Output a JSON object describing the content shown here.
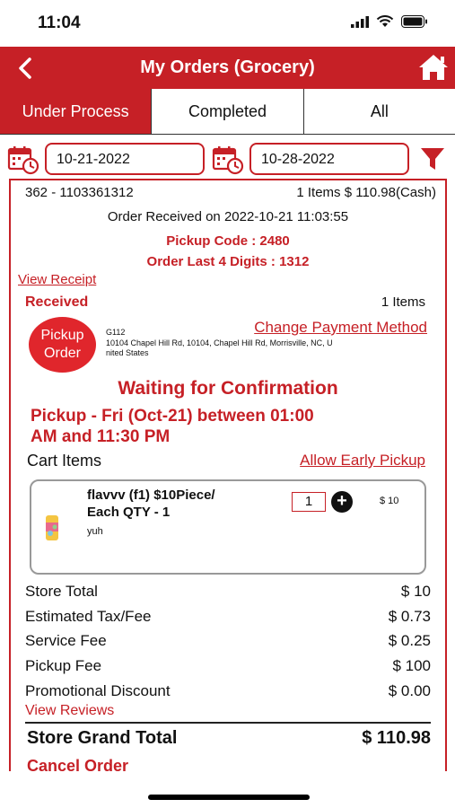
{
  "status_bar": {
    "time": "11:04"
  },
  "nav": {
    "title": "My Orders (Grocery)",
    "back_icon": "chevron-left-icon",
    "home_icon": "home-icon"
  },
  "tabs": [
    {
      "label": "Under Process",
      "active": true
    },
    {
      "label": "Completed",
      "active": false
    },
    {
      "label": "All",
      "active": false
    }
  ],
  "filters": {
    "from_date": "10-21-2022",
    "to_date": "10-28-2022"
  },
  "order": {
    "id": "362 - 1103361312",
    "summary": "1 Items $ 110.98(Cash)",
    "received_on": "Order Received on 2022-10-21 11:03:55",
    "pickup_code": "Pickup Code : 2480",
    "last4": "Order Last 4 Digits : 1312",
    "view_receipt": "View Receipt",
    "status": "Received",
    "items_count": "1 Items",
    "badge_line1": "Pickup",
    "badge_line2": "Order",
    "store_code": "G112",
    "change_payment": "Change Payment Method",
    "address": "10104 Chapel Hill Rd, 10104, Chapel Hill Rd, Morrisville, NC, United States",
    "address_line1": "10104 Chapel Hill Rd, 10104, Chapel Hill Rd, Morrisville, NC, U",
    "address_line2": "nited States",
    "waiting": "Waiting for Confirmation",
    "pickup_line1": "Pickup - Fri (Oct-21) between 01:00",
    "pickup_line2": "AM and 11:30 PM",
    "cart_items_label": "Cart Items",
    "allow_early": "Allow Early Pickup",
    "item": {
      "name_line1": "flavvv (f1) $10Piece/",
      "name_line2": "Each QTY - 1",
      "note": "yuh",
      "qty": "1",
      "price": "$ 10"
    },
    "totals": [
      {
        "label": "Store Total",
        "value": "$ 10"
      },
      {
        "label": "Estimated Tax/Fee",
        "value": "$ 0.73"
      },
      {
        "label": "Service Fee",
        "value": "$ 0.25"
      },
      {
        "label": "Pickup Fee",
        "value": "$ 100"
      },
      {
        "label": "Promotional Discount",
        "value": "$ 0.00"
      }
    ],
    "view_reviews": "View Reviews",
    "grand_label": "Store Grand Total",
    "grand_value": "$ 110.98",
    "cancel": "Cancel Order"
  },
  "colors": {
    "brand_red": "#c62026",
    "badge_red": "#e0262c"
  }
}
